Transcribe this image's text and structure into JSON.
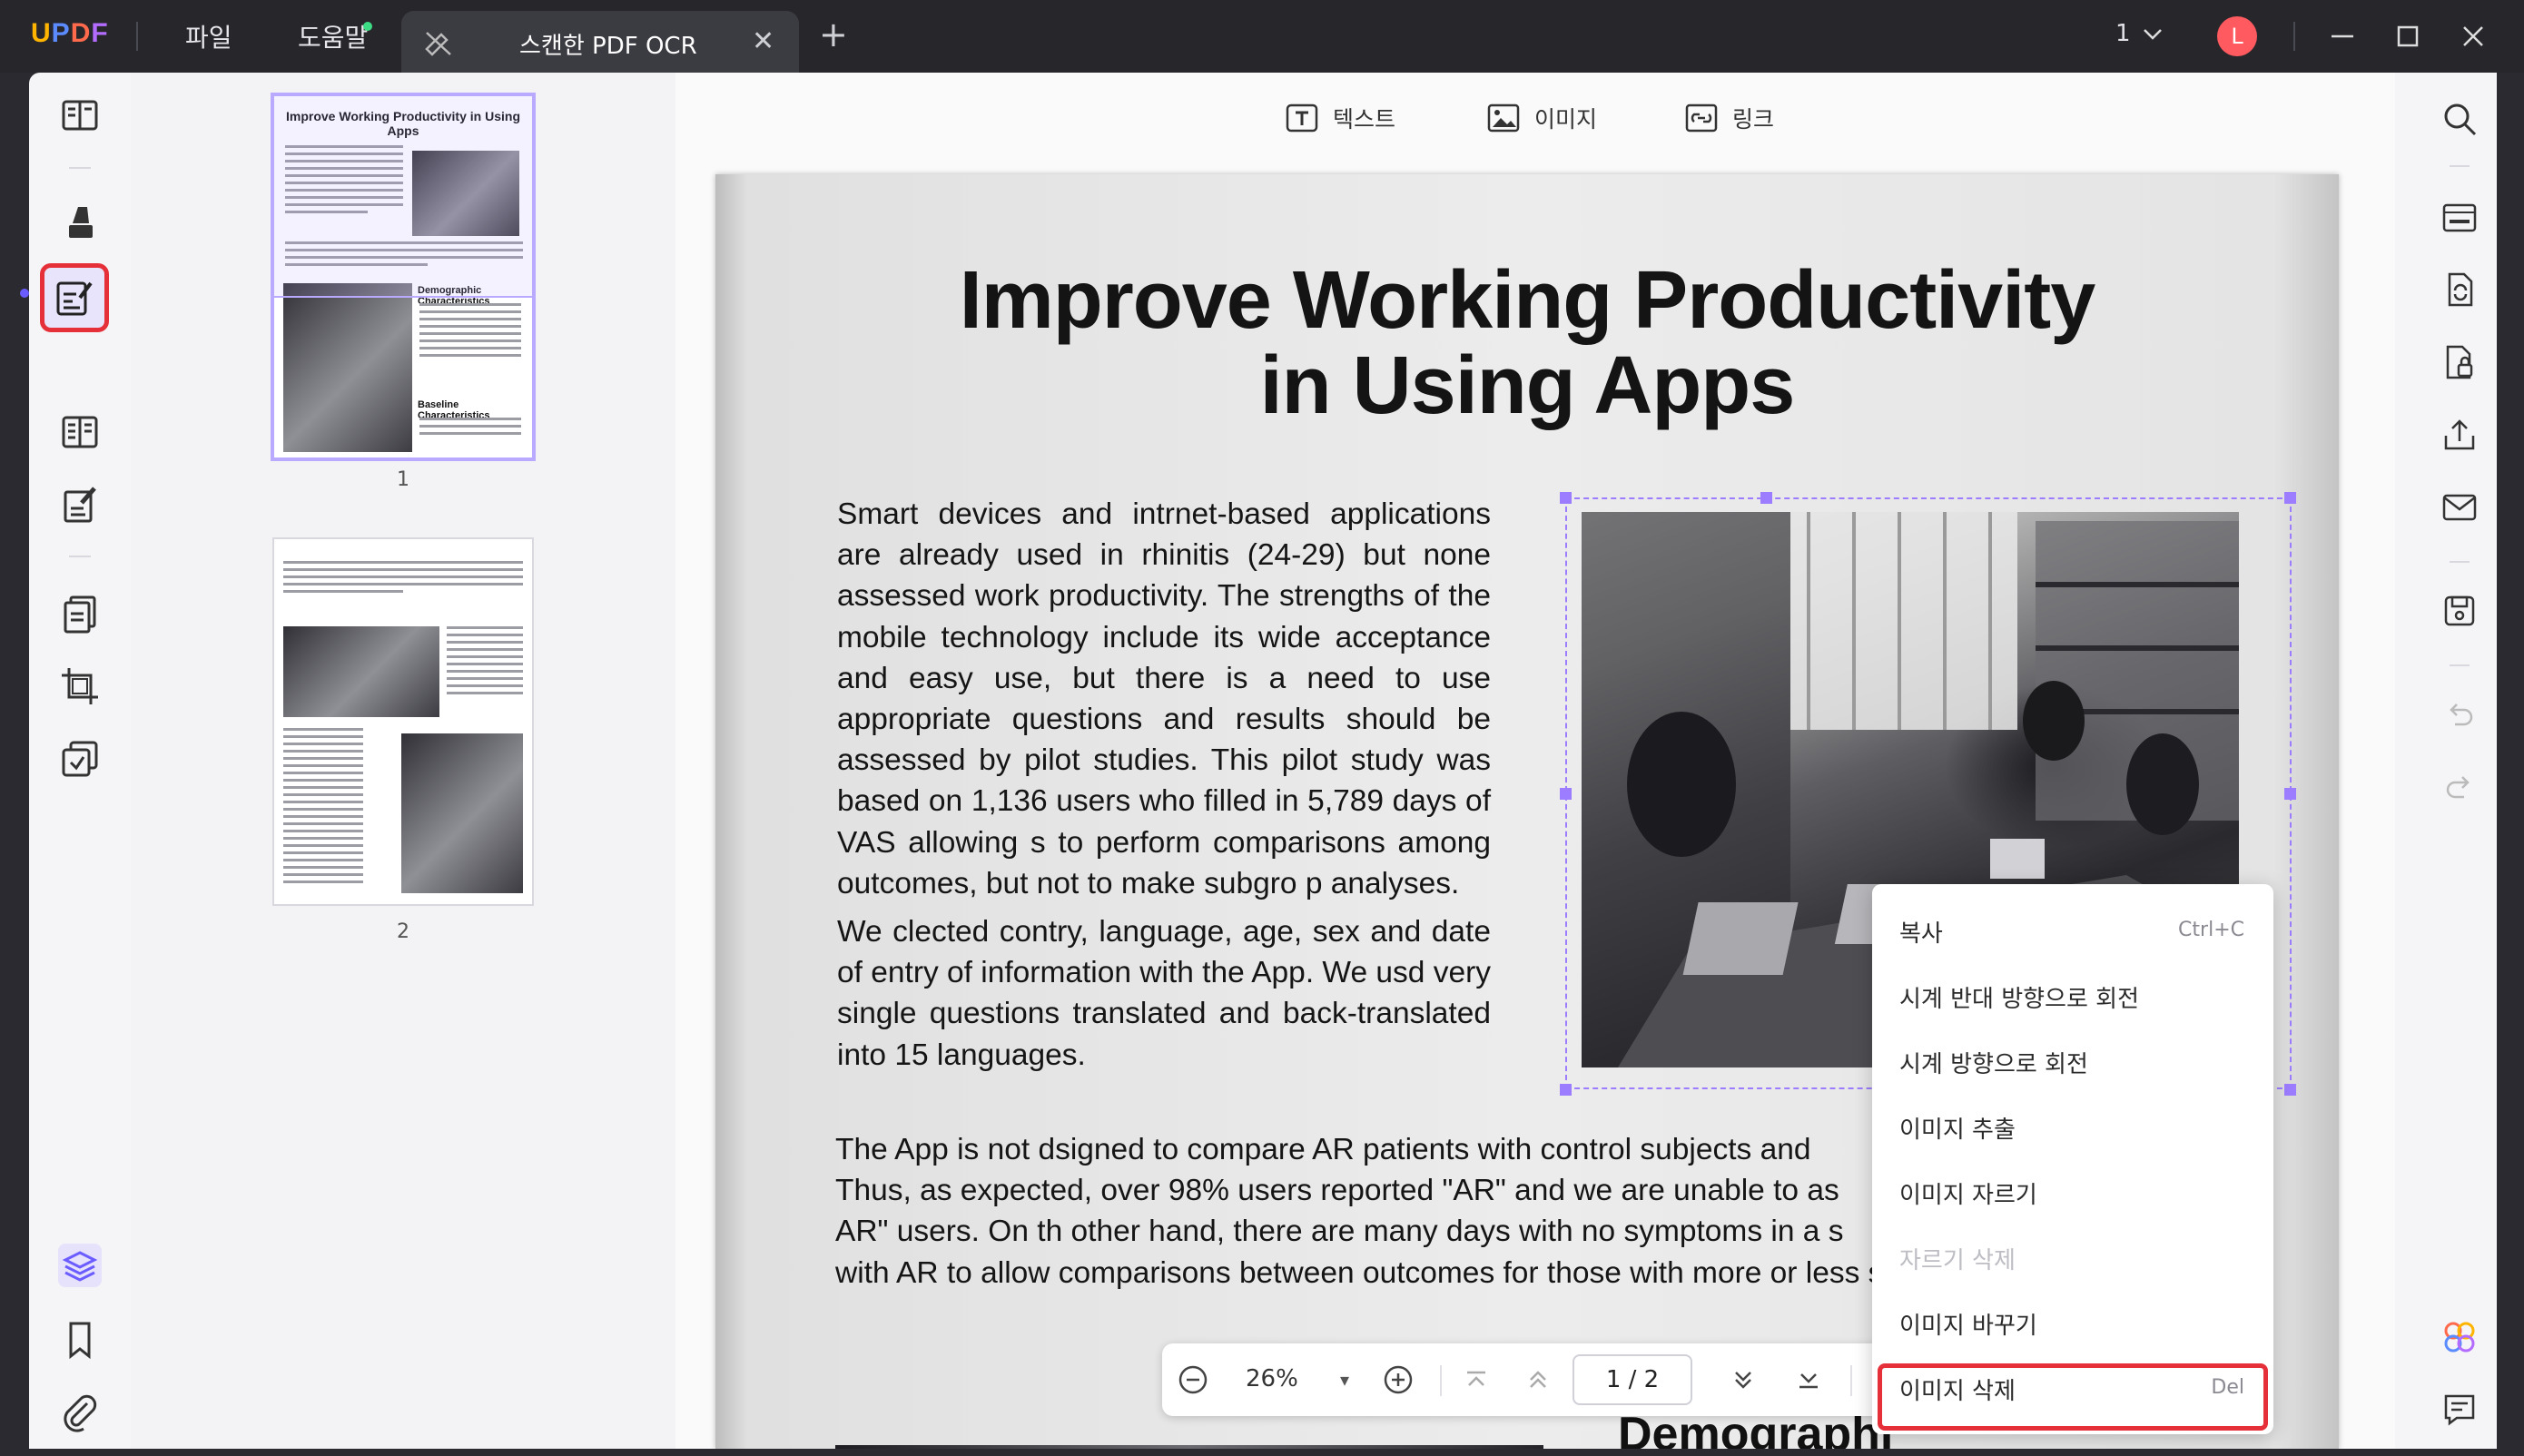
{
  "app": {
    "logo": "UPDF",
    "menus": [
      "파일",
      "도움말"
    ],
    "tab_title": "스캔한 PDF OCR",
    "tab_close": "✕",
    "tab_add": "+",
    "page_indicator": "1",
    "avatar_letter": "L"
  },
  "edit_toolbar": {
    "text_label": "텍스트",
    "image_label": "이미지",
    "link_label": "링크"
  },
  "thumbnails": [
    {
      "label": "1",
      "title": "Improve Working Productivity in Using Apps",
      "heading1": "Demographic Characteristics",
      "heading2": "Baseline Characteristics"
    },
    {
      "label": "2"
    }
  ],
  "document": {
    "title_line1": "Improve Working Productivity",
    "title_line2": "in Using Apps",
    "para1": "Smart devices and intrnet-based applications are already used in rhinitis (24-29) but none assessed work productivity. The strengths of the mobile technology include its wide acceptance and easy use, but there is a need to use appropriate questions and results should be assessed by pilot studies. This pilot study was based on 1,136 users who filled in 5,789 days of VAS allowing s to perform comparisons among outcomes, but not to make subgro p analyses.",
    "para2": "We clected contry, language, age, sex and date of entry of information with the App. We usd very single questions translated and back-translated into 15 languages.",
    "para3_lines": [
      "The App is not dsigned to compare AR patients with control subjects and",
      "Thus, as expected, over 98% users reported \"AR\" and we are unable to as",
      "AR\" users. On th other hand, there are many days with no symptoms in a s",
      "with AR to allow comparisons between outcomes for those with more or less s"
    ],
    "bottom_heading": "Demographi"
  },
  "navbar": {
    "zoom": "26%",
    "page_box": "1 / 2"
  },
  "context_menu": {
    "items": [
      {
        "label": "복사",
        "shortcut": "Ctrl+C",
        "enabled": true
      },
      {
        "label": "시계 반대 방향으로 회전",
        "shortcut": "",
        "enabled": true
      },
      {
        "label": "시계 방향으로 회전",
        "shortcut": "",
        "enabled": true
      },
      {
        "label": "이미지 추출",
        "shortcut": "",
        "enabled": true
      },
      {
        "label": "이미지 자르기",
        "shortcut": "",
        "enabled": true
      },
      {
        "label": "자르기 삭제",
        "shortcut": "",
        "enabled": false
      },
      {
        "label": "이미지 바꾸기",
        "shortcut": "",
        "enabled": true
      },
      {
        "label": "이미지 삭제",
        "shortcut": "Del",
        "enabled": true
      }
    ]
  },
  "colors": {
    "accent": "#6b5cff",
    "highlight_frame": "#e5303a",
    "selection": "#9c7dff",
    "titlebar": "#26262b"
  },
  "icons": {
    "left_rail": [
      "reader-icon",
      "highlighter-icon",
      "edit-pdf-icon",
      "organize-icon",
      "fill-sign-icon",
      "convert-icon",
      "crop-icon",
      "protect-icon",
      "layers-icon",
      "bookmark-icon",
      "attachment-icon"
    ],
    "right_rail": [
      "search-icon",
      "ocr-icon",
      "convert-icon",
      "protect-doc-icon",
      "share-icon",
      "email-icon",
      "save-icon",
      "undo-icon",
      "redo-icon",
      "ai-assistant-icon",
      "comment-icon"
    ]
  }
}
